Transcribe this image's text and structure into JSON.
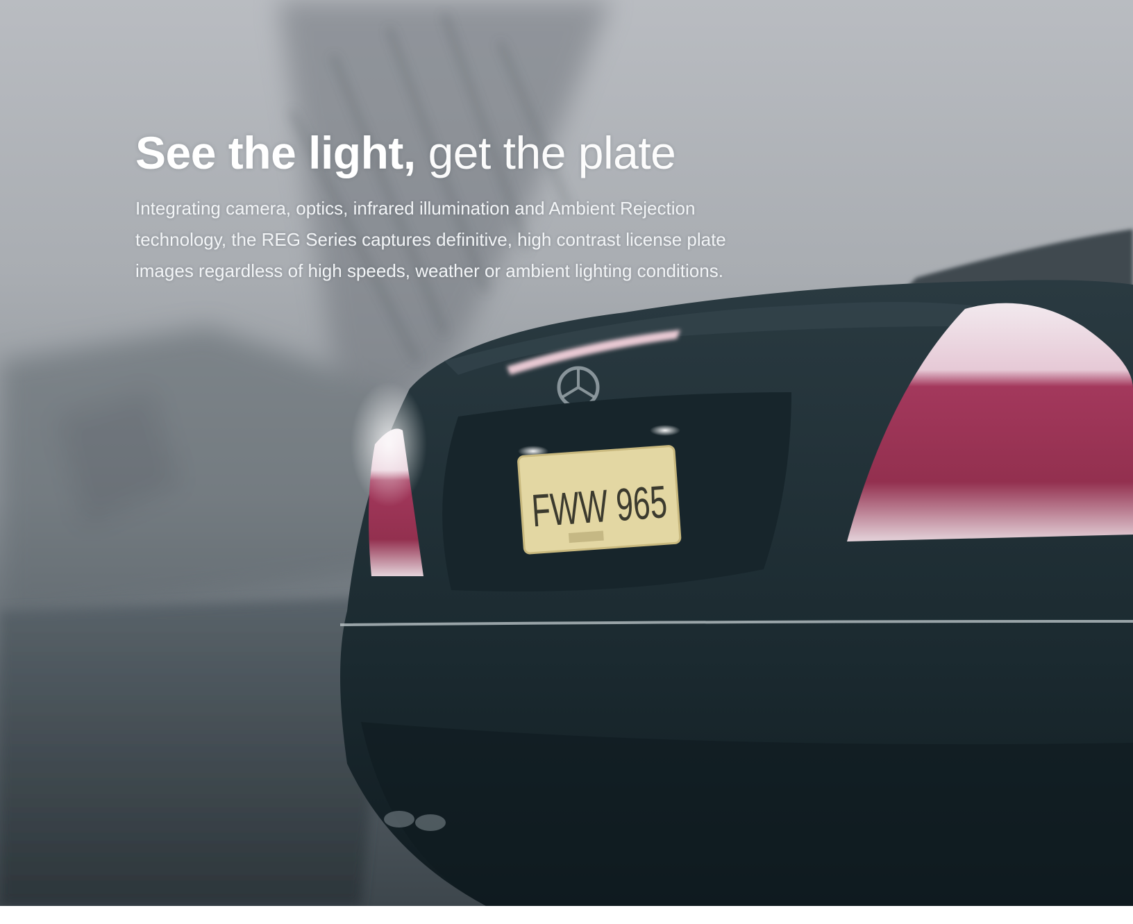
{
  "headline": {
    "bold": "See the light,",
    "light": "get the plate"
  },
  "body_text": "Integrating camera, optics, infrared illumination and Ambient Rejection technology, the REG Series captures definitive, high contrast license plate images regardless of high speeds, weather or ambient lighting conditions.",
  "plate": {
    "number": "FWW 965"
  },
  "colors": {
    "headline_text": "#ffffff",
    "car_body": "#1e2d33",
    "tail_light": "#a0355a",
    "plate_background": "#e3d7a3",
    "sky": "#b1b5ba"
  }
}
